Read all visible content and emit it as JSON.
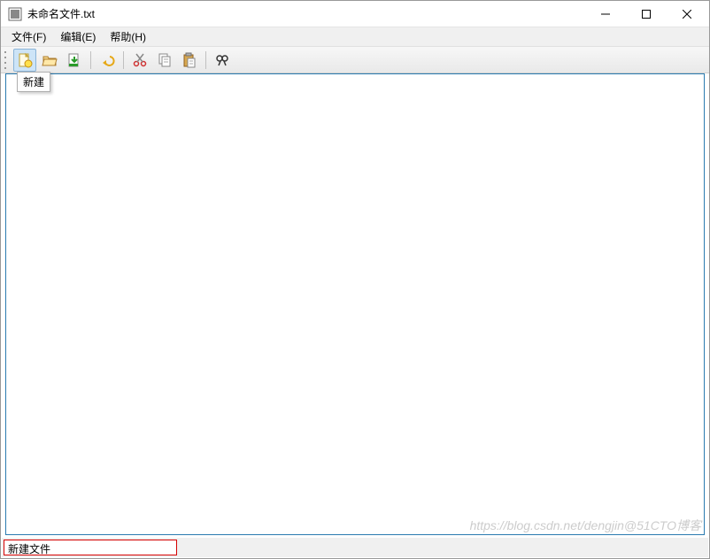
{
  "window": {
    "title": "未命名文件.txt"
  },
  "menu": {
    "file": "文件(F)",
    "edit": "编辑(E)",
    "help": "帮助(H)"
  },
  "toolbar": {
    "tooltip_new": "新建",
    "icons": {
      "new": "new-file-icon",
      "open": "open-folder-icon",
      "save": "save-icon",
      "undo": "undo-icon",
      "cut": "cut-icon",
      "copy": "copy-icon",
      "paste": "paste-icon",
      "find": "find-icon"
    }
  },
  "editor": {
    "content": ""
  },
  "statusbar": {
    "message": "新建文件"
  },
  "watermark": "https://blog.csdn.net/dengjin@51CTO博客"
}
